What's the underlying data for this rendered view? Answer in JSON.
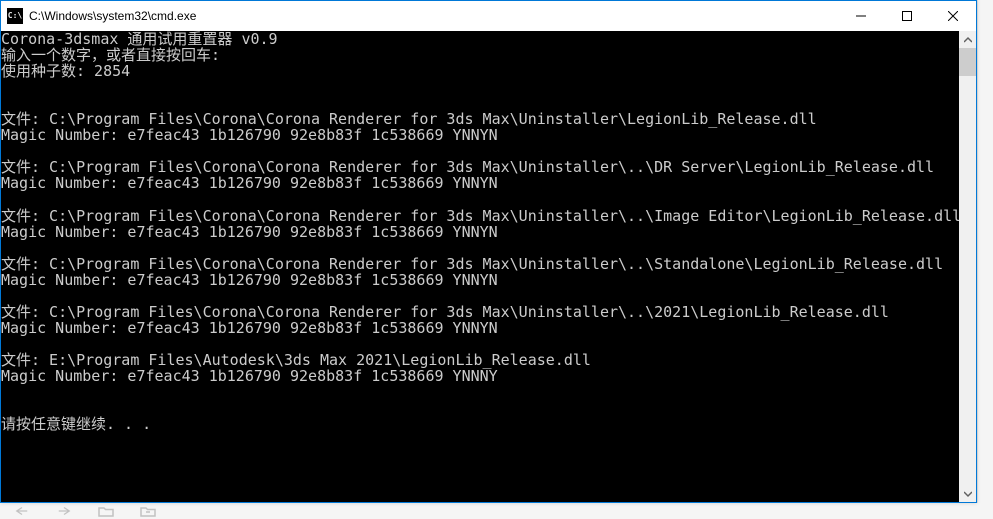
{
  "titlebar": {
    "icon_label": "C:\\",
    "title": "C:\\Windows\\system32\\cmd.exe"
  },
  "console": {
    "lines": [
      "Corona-3dsmax 通用试用重置器 v0.9",
      "输入一个数字，或者直接按回车:",
      "使用种子数: 2854",
      "",
      "",
      "文件: C:\\Program Files\\Corona\\Corona Renderer for 3ds Max\\Uninstaller\\LegionLib_Release.dll",
      "Magic Number: e7feac43 1b126790 92e8b83f 1c538669 YNNYN",
      "",
      "文件: C:\\Program Files\\Corona\\Corona Renderer for 3ds Max\\Uninstaller\\..\\DR Server\\LegionLib_Release.dll",
      "Magic Number: e7feac43 1b126790 92e8b83f 1c538669 YNNYN",
      "",
      "文件: C:\\Program Files\\Corona\\Corona Renderer for 3ds Max\\Uninstaller\\..\\Image Editor\\LegionLib_Release.dll",
      "Magic Number: e7feac43 1b126790 92e8b83f 1c538669 YNNYN",
      "",
      "文件: C:\\Program Files\\Corona\\Corona Renderer for 3ds Max\\Uninstaller\\..\\Standalone\\LegionLib_Release.dll",
      "Magic Number: e7feac43 1b126790 92e8b83f 1c538669 YNNYN",
      "",
      "文件: C:\\Program Files\\Corona\\Corona Renderer for 3ds Max\\Uninstaller\\..\\2021\\LegionLib_Release.dll",
      "Magic Number: e7feac43 1b126790 92e8b83f 1c538669 YNNYN",
      "",
      "文件: E:\\Program Files\\Autodesk\\3ds Max 2021\\LegionLib_Release.dll",
      "Magic Number: e7feac43 1b126790 92e8b83f 1c538669 YNNNY",
      "",
      "",
      "请按任意键继续. . ."
    ]
  }
}
